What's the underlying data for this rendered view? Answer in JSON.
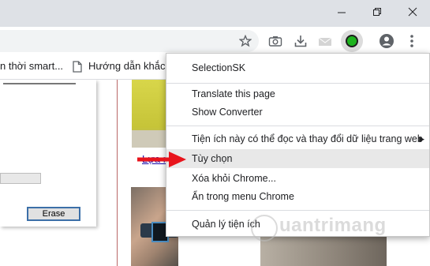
{
  "bookmarks": [
    {
      "label": "n thời smart...",
      "icon": "none"
    },
    {
      "label": "Hướng dẫn khắc p",
      "icon": "page-icon"
    }
  ],
  "toolbar_icons": [
    "star-icon",
    "camera-icon",
    "download-icon",
    "mail-icon",
    "extension-green-icon",
    "profile-icon",
    "more-vert-icon"
  ],
  "window_controls": [
    "minimize-icon",
    "restore-icon",
    "close-icon"
  ],
  "left_panel": {
    "erase_label": "Erase"
  },
  "page": {
    "link_text": "Lựa r"
  },
  "context_menu": {
    "title": "SelectionSK",
    "items": [
      "Translate this page",
      "Show Converter",
      "Tiện ích này có thể đọc và thay đổi dữ liệu trang web",
      "Tùy chọn",
      "Xóa khỏi Chrome...",
      "Ẩn trong menu Chrome",
      "Quản lý tiện ích"
    ],
    "highlighted_index": 3
  },
  "watermark": {
    "text": "uantrimang"
  },
  "colors": {
    "arrow": "#e8141c",
    "menu_highlight": "#e8e8e8",
    "extension_green": "#1db31d"
  }
}
